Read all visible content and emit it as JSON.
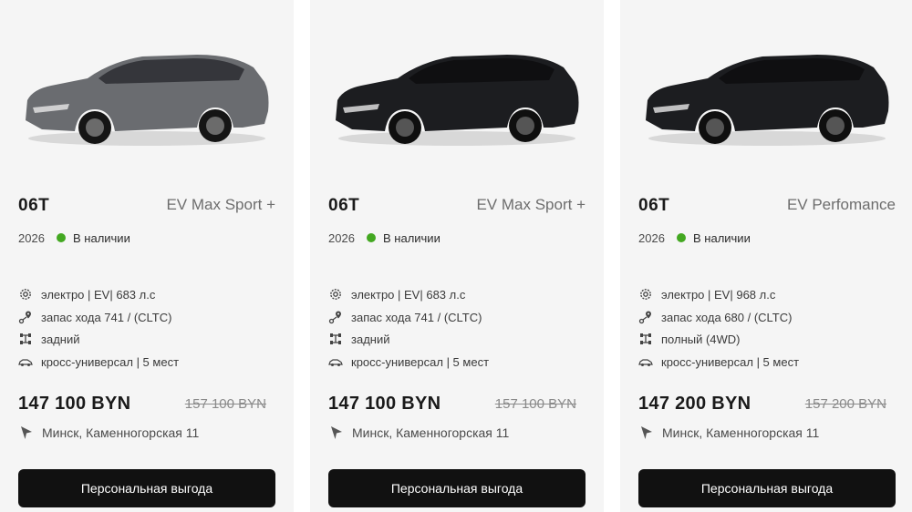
{
  "cards": [
    {
      "model": "06T",
      "trim": "EV Max Sport +",
      "year": "2026",
      "availability": "В наличии",
      "car_color": "#6a6c70",
      "specs": {
        "engine": "электро | EV| 683 л.с",
        "range": "запас хода 741 / (CLTC)",
        "drive": "задний",
        "body": "кросс-универсал | 5 мест"
      },
      "price": "147 100 BYN",
      "old_price": "157 100 BYN",
      "location": "Минск, Каменногорская 11",
      "button_label": "Персональная выгода"
    },
    {
      "model": "06T",
      "trim": "EV Max Sport +",
      "year": "2026",
      "availability": "В наличии",
      "car_color": "#1c1d20",
      "specs": {
        "engine": "электро | EV| 683 л.с",
        "range": "запас хода 741 / (CLTC)",
        "drive": "задний",
        "body": "кросс-универсал | 5 мест"
      },
      "price": "147 100 BYN",
      "old_price": "157 100 BYN",
      "location": "Минск, Каменногорская 11",
      "button_label": "Персональная выгода"
    },
    {
      "model": "06T",
      "trim": "EV Perfomance",
      "year": "2026",
      "availability": "В наличии",
      "car_color": "#1c1d20",
      "specs": {
        "engine": "электро | EV| 968 л.с",
        "range": "запас хода 680 / (CLTC)",
        "drive": "полный (4WD)",
        "body": "кросс-универсал | 5 мест"
      },
      "price": "147 200 BYN",
      "old_price": "157 200 BYN",
      "location": "Минск, Каменногорская 11",
      "button_label": "Персональная выгода"
    }
  ],
  "colors": {
    "card_bg": "#f5f5f5",
    "availability_dot": "#43a821",
    "button_bg": "#111111"
  },
  "icons": {
    "engine": "gear-icon",
    "range": "map-pin-route-icon",
    "drive": "drivetrain-icon",
    "body": "car-icon",
    "location": "navigation-arrow-icon"
  }
}
